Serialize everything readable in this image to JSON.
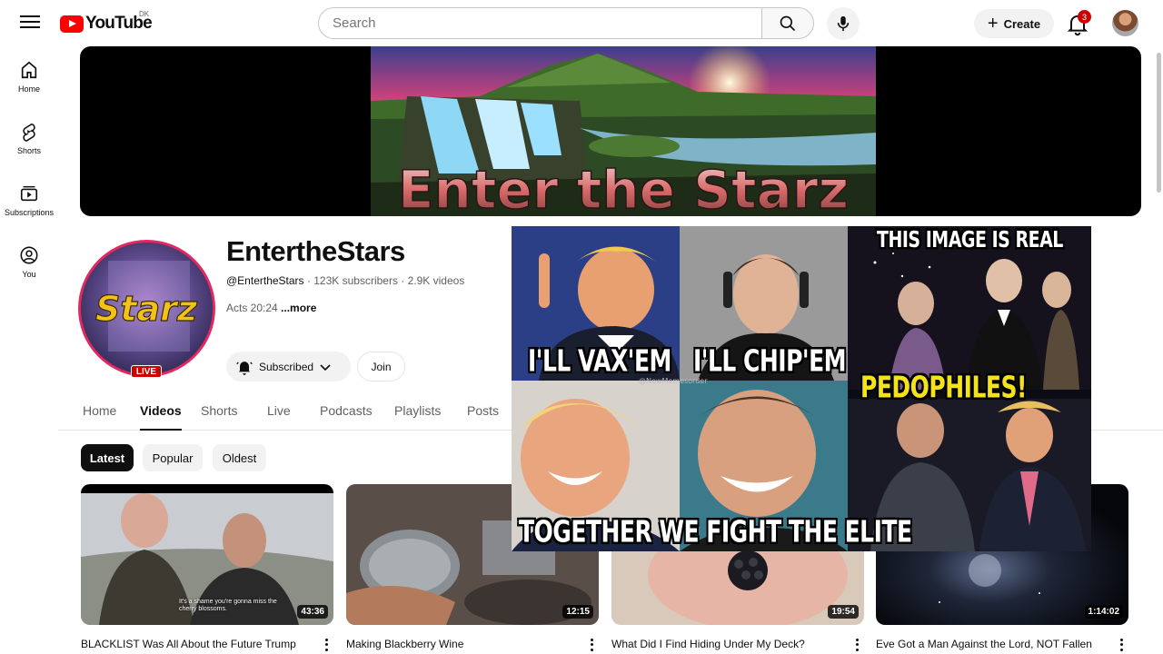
{
  "header": {
    "logo_text": "YouTube",
    "region": "DK",
    "search_placeholder": "Search",
    "create_label": "Create",
    "notification_count": "3"
  },
  "rail": [
    {
      "label": "Home",
      "icon": "home-icon"
    },
    {
      "label": "Shorts",
      "icon": "shorts-icon"
    },
    {
      "label": "Subscriptions",
      "icon": "subscriptions-icon"
    },
    {
      "label": "You",
      "icon": "you-icon"
    }
  ],
  "banner": {
    "art_text": "Enter the Starz",
    "art_word_small": "the"
  },
  "channel": {
    "name": "EntertheStars",
    "handle": "@EntertheStars",
    "subscribers": "123K subscribers",
    "videos": "2.9K videos",
    "separator": " · ",
    "description": "Acts 20:24 ",
    "more": "...more",
    "avatar_text": "Starz",
    "live": "LIVE",
    "subscribed_label": "Subscribed",
    "join_label": "Join"
  },
  "tabs": [
    "Home",
    "Videos",
    "Shorts",
    "Live",
    "Podcasts",
    "Playlists",
    "Posts"
  ],
  "active_tab": "Videos",
  "chips": [
    "Latest",
    "Popular",
    "Oldest"
  ],
  "active_chip": "Latest",
  "videos": [
    {
      "title": "BLACKLIST Was All About the Future Trump",
      "duration": "43:36",
      "subtitle": "It's a shame you're gonna miss the cherry blossoms."
    },
    {
      "title": "Making Blackberry Wine",
      "duration": "12:15"
    },
    {
      "title": "What Did I Find Hiding Under My Deck?",
      "duration": "19:54"
    },
    {
      "title": "Eve Got a Man Against the Lord, NOT Fallen",
      "duration": "1:14:02"
    }
  ],
  "meme": {
    "caption_1": "I'LL VAX'EM",
    "caption_2": "I'LL CHIP'EM",
    "caption_3": "TOGETHER WE FIGHT THE ELITE",
    "caption_4": "THIS IMAGE IS REAL",
    "caption_5": "PEDOPHILES!",
    "watermark": "@NewMemesorder"
  },
  "colors": {
    "brand_red": "#ff0000",
    "live_red": "#cc0000",
    "avatar_ring": "#e3275f",
    "meme_yellow": "#f5e31a"
  }
}
